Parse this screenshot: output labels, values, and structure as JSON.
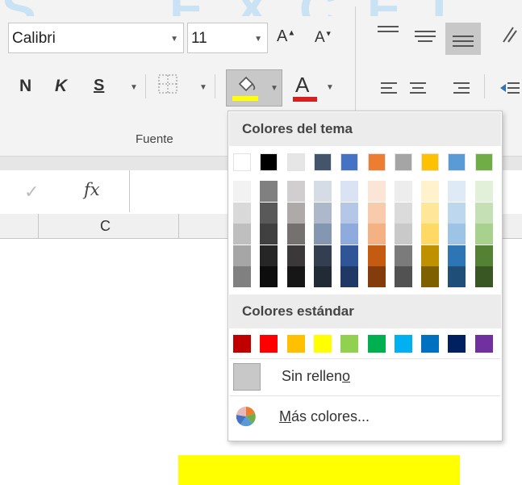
{
  "font": {
    "name": "Calibri",
    "size": "11",
    "grow_label": "A",
    "shrink_label": "A"
  },
  "format": {
    "bold": "N",
    "italic": "K",
    "underline": "S",
    "font_color_label": "A"
  },
  "group_label": "Fuente",
  "formula_bar": {
    "fx_label": "fx"
  },
  "column_header": "C",
  "colors": {
    "font_color_underline": "#d61f1f",
    "fill_color_underline": "#ffff00",
    "cell_fill": "#ffff00"
  },
  "dropdown": {
    "theme_title": "Colores del tema",
    "theme_base": [
      "#ffffff",
      "#000000",
      "#e7e6e6",
      "#44546a",
      "#4472c4",
      "#ed7d31",
      "#a5a5a5",
      "#ffc000",
      "#5b9bd5",
      "#70ad47"
    ],
    "theme_shades": [
      [
        "#f2f2f2",
        "#d9d9d9",
        "#bfbfbf",
        "#a6a6a6",
        "#808080"
      ],
      [
        "#808080",
        "#595959",
        "#404040",
        "#262626",
        "#0d0d0d"
      ],
      [
        "#d0cece",
        "#aeaaaa",
        "#757171",
        "#3a3838",
        "#171616"
      ],
      [
        "#d6dce5",
        "#adb9ca",
        "#8497b0",
        "#333f50",
        "#222b35"
      ],
      [
        "#dae3f3",
        "#b4c7e7",
        "#8faadc",
        "#2f5597",
        "#1f3864"
      ],
      [
        "#fbe5d6",
        "#f8cbad",
        "#f4b183",
        "#c55a11",
        "#843c0c"
      ],
      [
        "#ededed",
        "#dbdbdb",
        "#c9c9c9",
        "#7b7b7b",
        "#525252"
      ],
      [
        "#fff2cc",
        "#ffe699",
        "#ffd966",
        "#bf9000",
        "#7f6000"
      ],
      [
        "#deebf7",
        "#bdd7ee",
        "#9dc3e6",
        "#2e75b6",
        "#1f4e79"
      ],
      [
        "#e2f0d9",
        "#c5e0b4",
        "#a9d18e",
        "#548235",
        "#385723"
      ]
    ],
    "standard_title": "Colores estándar",
    "standard": [
      "#c00000",
      "#ff0000",
      "#ffc000",
      "#ffff00",
      "#92d050",
      "#00b050",
      "#00b0f0",
      "#0070c0",
      "#002060",
      "#7030a0"
    ],
    "no_fill_pre": "Sin rellen",
    "no_fill_key": "o",
    "more_key": "M",
    "more_rest": "ás colores..."
  }
}
